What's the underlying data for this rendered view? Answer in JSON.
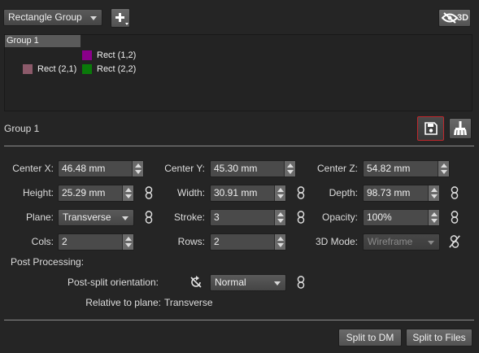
{
  "toolbar": {
    "group_type": "Rectangle Group",
    "add_label": "+",
    "view_3d_label": "3D"
  },
  "tree": {
    "group_label": "Group 1",
    "items": [
      {
        "label": "Rect (1,2)",
        "color": "#8a008a"
      },
      {
        "label": "Rect (2,1)",
        "color": "#8c5a6a"
      },
      {
        "label": "Rect (2,2)",
        "color": "#0a7a0a"
      }
    ]
  },
  "panel": {
    "title": "Group 1"
  },
  "fields": {
    "center_x": {
      "label": "Center X:",
      "value": "46.48 mm"
    },
    "center_y": {
      "label": "Center Y:",
      "value": "45.30 mm"
    },
    "center_z": {
      "label": "Center Z:",
      "value": "54.82 mm"
    },
    "height": {
      "label": "Height:",
      "value": "25.29 mm"
    },
    "width": {
      "label": "Width:",
      "value": "30.91 mm"
    },
    "depth": {
      "label": "Depth:",
      "value": "98.73 mm"
    },
    "plane": {
      "label": "Plane:",
      "value": "Transverse"
    },
    "stroke": {
      "label": "Stroke:",
      "value": "3"
    },
    "opacity": {
      "label": "Opacity:",
      "value": "100%"
    },
    "cols": {
      "label": "Cols:",
      "value": "2"
    },
    "rows": {
      "label": "Rows:",
      "value": "2"
    },
    "mode_3d": {
      "label": "3D Mode:",
      "value": "Wireframe"
    }
  },
  "post": {
    "heading": "Post Processing:",
    "orientation_label": "Post-split orientation:",
    "orientation_value": "Normal",
    "relative_label": "Relative to plane:",
    "relative_value": "Transverse"
  },
  "actions": {
    "split_dm": "Split to DM",
    "split_files": "Split to Files"
  },
  "colors": {
    "accent_red": "#c0282d"
  }
}
